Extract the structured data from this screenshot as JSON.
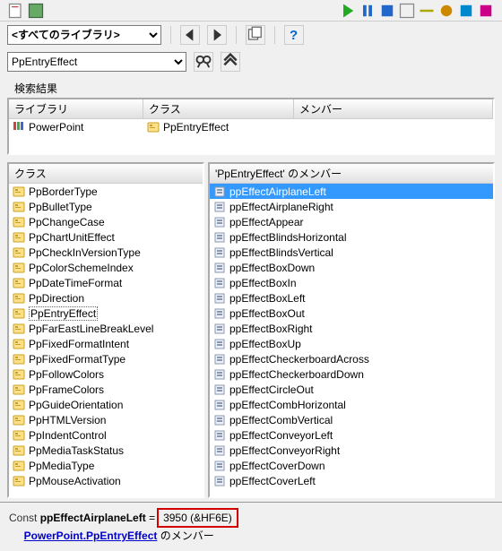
{
  "toolbar_top": {
    "icons": [
      "doc",
      "save",
      "cut",
      "copy",
      "paste",
      "find",
      "undo",
      "redo",
      "play",
      "pause",
      "stop",
      "step",
      "bp",
      "design",
      "props",
      "help"
    ]
  },
  "row_lib": {
    "combo_value": "<すべてのライブラリ>",
    "btn_prev": "◀",
    "btn_next": "▶",
    "btn_copy_mod": "copy",
    "btn_help": "?"
  },
  "row_search": {
    "combo_value": "PpEntryEffect",
    "btn_search": "find",
    "btn_collapse": "⌃"
  },
  "search_results": {
    "label": "検索結果",
    "headers": {
      "lib": "ライブラリ",
      "cls": "クラス",
      "mem": "メンバー"
    },
    "rows": [
      {
        "lib": "PowerPoint",
        "cls": "PpEntryEffect",
        "mem": ""
      }
    ]
  },
  "panes": {
    "left": {
      "header": "クラス",
      "selected": "PpEntryEffect",
      "items": [
        "PpBorderType",
        "PpBulletType",
        "PpChangeCase",
        "PpChartUnitEffect",
        "PpCheckInVersionType",
        "PpColorSchemeIndex",
        "PpDateTimeFormat",
        "PpDirection",
        "PpEntryEffect",
        "PpFarEastLineBreakLevel",
        "PpFixedFormatIntent",
        "PpFixedFormatType",
        "PpFollowColors",
        "PpFrameColors",
        "PpGuideOrientation",
        "PpHTMLVersion",
        "PpIndentControl",
        "PpMediaTaskStatus",
        "PpMediaType",
        "PpMouseActivation"
      ]
    },
    "right": {
      "header": "'PpEntryEffect' のメンバー",
      "selected": "ppEffectAirplaneLeft",
      "items": [
        "ppEffectAirplaneLeft",
        "ppEffectAirplaneRight",
        "ppEffectAppear",
        "ppEffectBlindsHorizontal",
        "ppEffectBlindsVertical",
        "ppEffectBoxDown",
        "ppEffectBoxIn",
        "ppEffectBoxLeft",
        "ppEffectBoxOut",
        "ppEffectBoxRight",
        "ppEffectBoxUp",
        "ppEffectCheckerboardAcross",
        "ppEffectCheckerboardDown",
        "ppEffectCircleOut",
        "ppEffectCombHorizontal",
        "ppEffectCombVertical",
        "ppEffectConveyorLeft",
        "ppEffectConveyorRight",
        "ppEffectCoverDown",
        "ppEffectCoverLeft"
      ]
    }
  },
  "footer": {
    "keyword": "Const",
    "name": "ppEffectAirplaneLeft",
    "equals": "=",
    "value": "3950 (&HF6E)",
    "link_lib": "PowerPoint",
    "link_sep": ".",
    "link_cls": "PpEntryEffect",
    "suffix": " のメンバー"
  }
}
